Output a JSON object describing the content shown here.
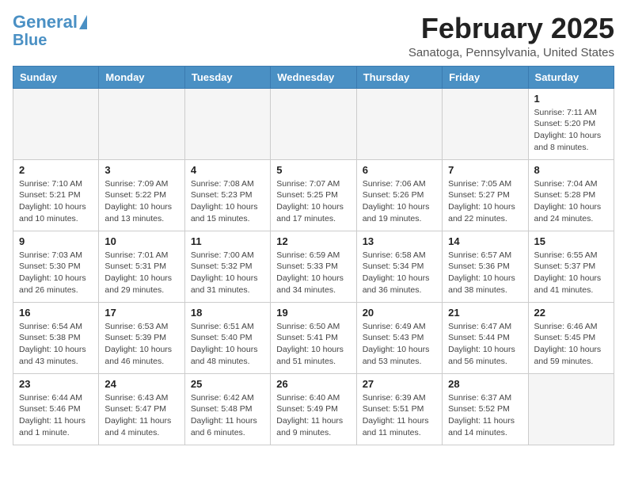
{
  "header": {
    "logo_general": "General",
    "logo_blue": "Blue",
    "month_title": "February 2025",
    "location": "Sanatoga, Pennsylvania, United States"
  },
  "days_of_week": [
    "Sunday",
    "Monday",
    "Tuesday",
    "Wednesday",
    "Thursday",
    "Friday",
    "Saturday"
  ],
  "weeks": [
    [
      {
        "day": "",
        "info": ""
      },
      {
        "day": "",
        "info": ""
      },
      {
        "day": "",
        "info": ""
      },
      {
        "day": "",
        "info": ""
      },
      {
        "day": "",
        "info": ""
      },
      {
        "day": "",
        "info": ""
      },
      {
        "day": "1",
        "info": "Sunrise: 7:11 AM\nSunset: 5:20 PM\nDaylight: 10 hours and 8 minutes."
      }
    ],
    [
      {
        "day": "2",
        "info": "Sunrise: 7:10 AM\nSunset: 5:21 PM\nDaylight: 10 hours and 10 minutes."
      },
      {
        "day": "3",
        "info": "Sunrise: 7:09 AM\nSunset: 5:22 PM\nDaylight: 10 hours and 13 minutes."
      },
      {
        "day": "4",
        "info": "Sunrise: 7:08 AM\nSunset: 5:23 PM\nDaylight: 10 hours and 15 minutes."
      },
      {
        "day": "5",
        "info": "Sunrise: 7:07 AM\nSunset: 5:25 PM\nDaylight: 10 hours and 17 minutes."
      },
      {
        "day": "6",
        "info": "Sunrise: 7:06 AM\nSunset: 5:26 PM\nDaylight: 10 hours and 19 minutes."
      },
      {
        "day": "7",
        "info": "Sunrise: 7:05 AM\nSunset: 5:27 PM\nDaylight: 10 hours and 22 minutes."
      },
      {
        "day": "8",
        "info": "Sunrise: 7:04 AM\nSunset: 5:28 PM\nDaylight: 10 hours and 24 minutes."
      }
    ],
    [
      {
        "day": "9",
        "info": "Sunrise: 7:03 AM\nSunset: 5:30 PM\nDaylight: 10 hours and 26 minutes."
      },
      {
        "day": "10",
        "info": "Sunrise: 7:01 AM\nSunset: 5:31 PM\nDaylight: 10 hours and 29 minutes."
      },
      {
        "day": "11",
        "info": "Sunrise: 7:00 AM\nSunset: 5:32 PM\nDaylight: 10 hours and 31 minutes."
      },
      {
        "day": "12",
        "info": "Sunrise: 6:59 AM\nSunset: 5:33 PM\nDaylight: 10 hours and 34 minutes."
      },
      {
        "day": "13",
        "info": "Sunrise: 6:58 AM\nSunset: 5:34 PM\nDaylight: 10 hours and 36 minutes."
      },
      {
        "day": "14",
        "info": "Sunrise: 6:57 AM\nSunset: 5:36 PM\nDaylight: 10 hours and 38 minutes."
      },
      {
        "day": "15",
        "info": "Sunrise: 6:55 AM\nSunset: 5:37 PM\nDaylight: 10 hours and 41 minutes."
      }
    ],
    [
      {
        "day": "16",
        "info": "Sunrise: 6:54 AM\nSunset: 5:38 PM\nDaylight: 10 hours and 43 minutes."
      },
      {
        "day": "17",
        "info": "Sunrise: 6:53 AM\nSunset: 5:39 PM\nDaylight: 10 hours and 46 minutes."
      },
      {
        "day": "18",
        "info": "Sunrise: 6:51 AM\nSunset: 5:40 PM\nDaylight: 10 hours and 48 minutes."
      },
      {
        "day": "19",
        "info": "Sunrise: 6:50 AM\nSunset: 5:41 PM\nDaylight: 10 hours and 51 minutes."
      },
      {
        "day": "20",
        "info": "Sunrise: 6:49 AM\nSunset: 5:43 PM\nDaylight: 10 hours and 53 minutes."
      },
      {
        "day": "21",
        "info": "Sunrise: 6:47 AM\nSunset: 5:44 PM\nDaylight: 10 hours and 56 minutes."
      },
      {
        "day": "22",
        "info": "Sunrise: 6:46 AM\nSunset: 5:45 PM\nDaylight: 10 hours and 59 minutes."
      }
    ],
    [
      {
        "day": "23",
        "info": "Sunrise: 6:44 AM\nSunset: 5:46 PM\nDaylight: 11 hours and 1 minute."
      },
      {
        "day": "24",
        "info": "Sunrise: 6:43 AM\nSunset: 5:47 PM\nDaylight: 11 hours and 4 minutes."
      },
      {
        "day": "25",
        "info": "Sunrise: 6:42 AM\nSunset: 5:48 PM\nDaylight: 11 hours and 6 minutes."
      },
      {
        "day": "26",
        "info": "Sunrise: 6:40 AM\nSunset: 5:49 PM\nDaylight: 11 hours and 9 minutes."
      },
      {
        "day": "27",
        "info": "Sunrise: 6:39 AM\nSunset: 5:51 PM\nDaylight: 11 hours and 11 minutes."
      },
      {
        "day": "28",
        "info": "Sunrise: 6:37 AM\nSunset: 5:52 PM\nDaylight: 11 hours and 14 minutes."
      },
      {
        "day": "",
        "info": ""
      }
    ]
  ]
}
